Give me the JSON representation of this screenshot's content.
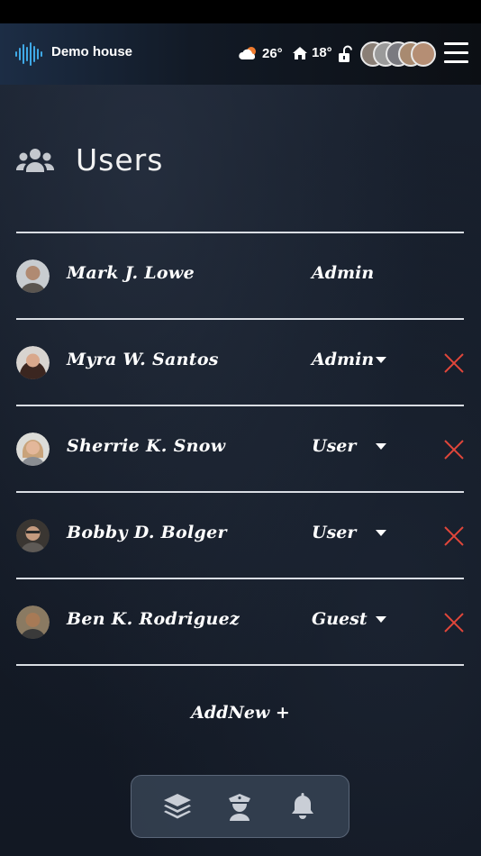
{
  "header": {
    "house_name": "Demo house",
    "outdoor_temp": "26°",
    "indoor_temp": "18°",
    "weather_icon": "cloud-sun-icon",
    "home_icon": "home-icon",
    "lock_icon": "unlocked-icon",
    "menu_icon": "hamburger-menu-icon"
  },
  "page": {
    "title": "Users",
    "icon": "users-group-icon"
  },
  "users": [
    {
      "name": "Mark J. Lowe",
      "role": "Admin",
      "editable": false,
      "avatar_color": "#8a7f76"
    },
    {
      "name": "Myra W. Santos",
      "role": "Admin",
      "editable": true,
      "avatar_color": "#5a3d33"
    },
    {
      "name": "Sherrie K. Snow",
      "role": "User",
      "editable": true,
      "avatar_color": "#b89a7e"
    },
    {
      "name": "Bobby D. Bolger",
      "role": "User",
      "editable": true,
      "avatar_color": "#6e6a64"
    },
    {
      "name": "Ben K. Rodriguez",
      "role": "Guest",
      "editable": true,
      "avatar_color": "#7a5e44"
    }
  ],
  "add_new_label": "AddNew +",
  "bottom_nav": [
    {
      "icon": "layers-icon"
    },
    {
      "icon": "police-officer-icon"
    },
    {
      "icon": "bell-icon"
    }
  ],
  "colors": {
    "accent_remove": "#e0463a",
    "divider": "#d9dde3",
    "nav_icon": "#c9ced6"
  }
}
